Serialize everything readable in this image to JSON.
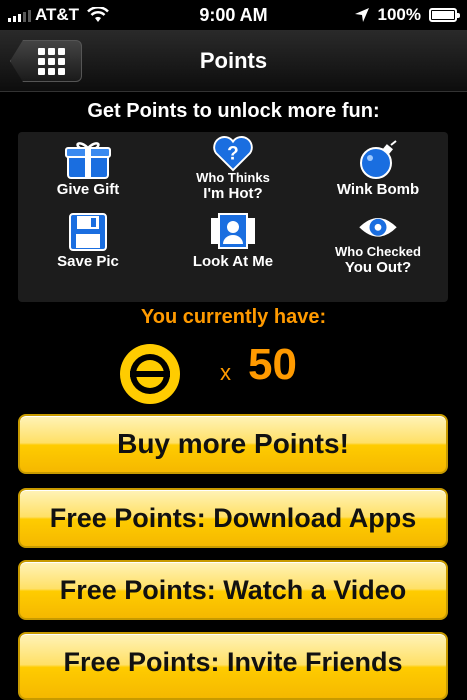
{
  "status_bar": {
    "carrier": "AT&T",
    "time": "9:00 AM",
    "battery": "100%",
    "battery_level": 1.0
  },
  "nav": {
    "title": "Points",
    "back_icon": "grid-icon"
  },
  "headline": "Get Points to unlock more fun:",
  "features": [
    {
      "label": "Give Gift",
      "icon": "gift-icon"
    },
    {
      "label_line1": "Who Thinks",
      "label_line2": "I'm Hot?",
      "icon": "heart-question-icon"
    },
    {
      "label": "Wink Bomb",
      "icon": "bomb-icon"
    },
    {
      "label": "Save Pic",
      "icon": "floppy-disk-icon"
    },
    {
      "label": "Look At Me",
      "icon": "spotlight-photo-icon"
    },
    {
      "label_line1": "Who Checked",
      "label_line2": "You Out?",
      "icon": "eye-icon"
    }
  ],
  "balance": {
    "label": "You currently have:",
    "multiplier": "x",
    "points": "50"
  },
  "buttons": {
    "buy": "Buy more Points!",
    "download_apps": "Free Points: Download Apps",
    "watch_video": "Free Points: Watch a Video",
    "invite_friends": "Free Points: Invite Friends"
  },
  "colors": {
    "accent": "#ff9a00",
    "button_yellow": "#ffcc00",
    "icon_blue": "#1a6ee0"
  }
}
